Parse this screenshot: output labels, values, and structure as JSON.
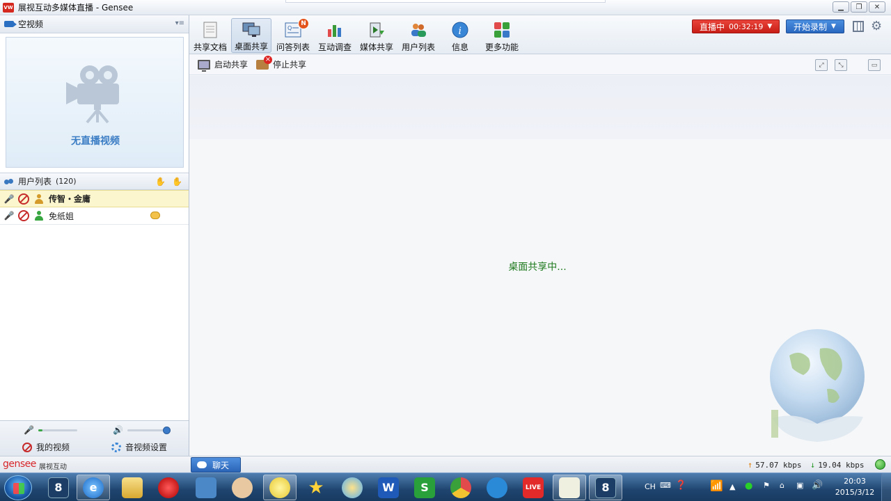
{
  "window": {
    "title": "展视互动多媒体直播 - Gensee",
    "logo_text": "VW"
  },
  "video_panel": {
    "title": "空视频",
    "no_video_text": "无直播视频"
  },
  "users_panel": {
    "title": "用户列表",
    "count": "(120)",
    "users": [
      {
        "name": "传智・金庸",
        "role": "host"
      },
      {
        "name": "免纸姐",
        "role": "attendee"
      }
    ]
  },
  "av_controls": {
    "my_video_label": "我的视频",
    "av_settings_label": "音视频设置",
    "mic_level": 0.1,
    "speaker_level": 0.95
  },
  "toolbar": {
    "items": [
      {
        "label": "共享文档",
        "icon": "document-icon"
      },
      {
        "label": "桌面共享",
        "icon": "desktop-share-icon",
        "active": true
      },
      {
        "label": "问答列表",
        "icon": "qa-icon",
        "badge": "N"
      },
      {
        "label": "互动调查",
        "icon": "survey-chart-icon"
      },
      {
        "label": "媒体共享",
        "icon": "media-share-icon"
      },
      {
        "label": "用户列表",
        "icon": "users-icon"
      },
      {
        "label": "信息",
        "icon": "info-icon"
      },
      {
        "label": "更多功能",
        "icon": "more-apps-icon"
      }
    ],
    "live_label": "直播中",
    "live_timer": "00:32:19",
    "record_label": "开始录制"
  },
  "subbar": {
    "start_share": "启动共享",
    "stop_share": "停止共享"
  },
  "main": {
    "status_text": "桌面共享中..."
  },
  "statusbar": {
    "brand": "gensee",
    "brand_sub": "展视互动",
    "chat_label": "聊天",
    "upload_rate": "57.07 kbps",
    "download_rate": "19.04 kbps"
  },
  "taskbar": {
    "lang": "CH",
    "time": "20:03",
    "date": "2015/3/12"
  },
  "colors": {
    "live_red": "#d8281e",
    "record_blue": "#2f6fc6",
    "status_green": "#1d7a1d",
    "brand_red": "#d7262a"
  }
}
